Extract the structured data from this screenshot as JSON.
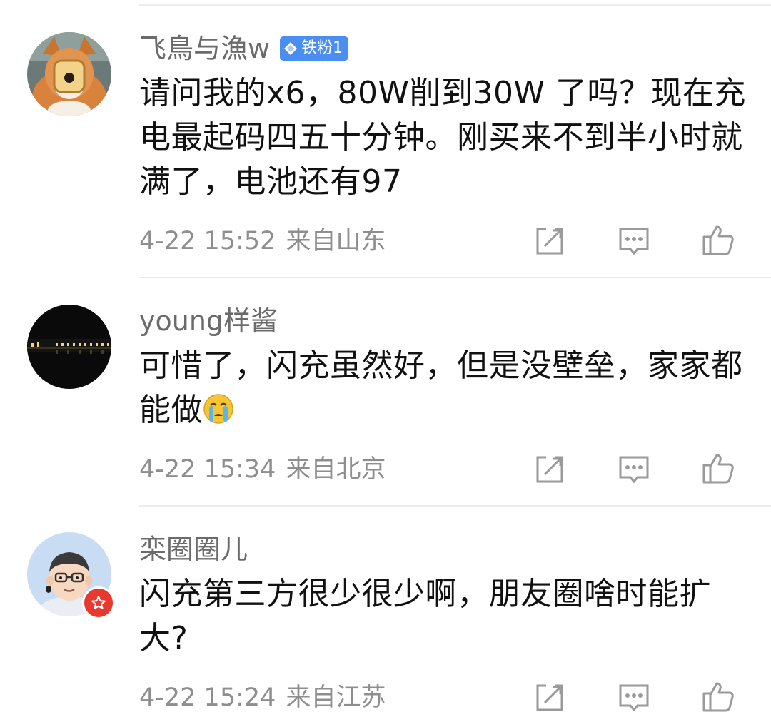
{
  "comments": [
    {
      "username": "飞鳥与漁w",
      "badge": "铁粉1",
      "text": "请问我的x6，80W削到30W 了吗？现在充电最起码四五十分钟。刚买来不到半小时就满了，电池还有97",
      "time": "4-22 15:52",
      "location": "来自山东",
      "avatar": "corgi-avatar"
    },
    {
      "username": "young样酱",
      "text": "可惜了，闪充虽然好，但是没壁垒，家家都能做",
      "emoji": "crying-face-icon",
      "time": "4-22 15:34",
      "location": "来自北京",
      "avatar": "night-scene-avatar"
    },
    {
      "username": "栾圈圈儿",
      "text": "闪充第三方很少很少啊，朋友圈啥时能扩大?",
      "time": "4-22 15:24",
      "location": "来自江苏",
      "avatar": "cartoon-boy-avatar"
    }
  ],
  "colors": {
    "text": "#111111",
    "username": "#6b6b6b",
    "meta": "#8e8e8e",
    "badge": "#4a8ef2",
    "verified": "#e8392f"
  }
}
